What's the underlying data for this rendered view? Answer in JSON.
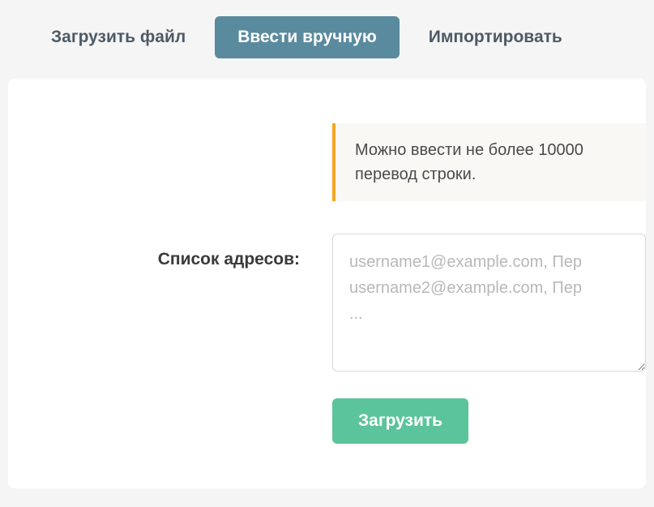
{
  "tabs": {
    "upload_file": "Загрузить файл",
    "enter_manually": "Ввести вручную",
    "import": "Импортировать"
  },
  "info": {
    "text": "Можно ввести не более 10000 перевод строки."
  },
  "form": {
    "address_list_label": "Список адресов:",
    "textarea_placeholder": "username1@example.com, Пер\nusername2@example.com, Пер\n..."
  },
  "buttons": {
    "submit": "Загрузить"
  }
}
